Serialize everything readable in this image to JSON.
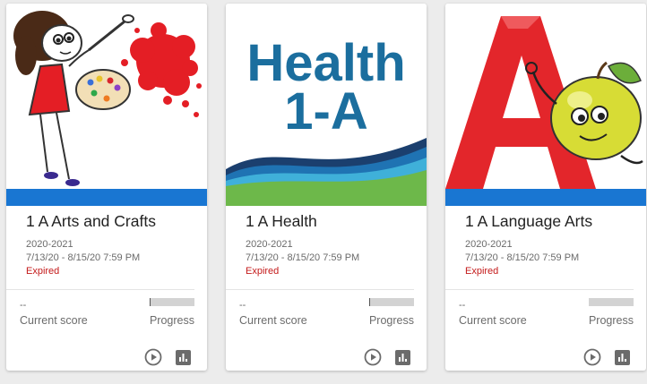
{
  "theme": {
    "accent_color": "#1976d2",
    "status_color": "#c41a1a",
    "icon_color": "#6b6b6b"
  },
  "courses": [
    {
      "thumbnail": "paint-girl-illustration",
      "title": "1 A Arts and Crafts",
      "term": "2020-2021",
      "dates": "7/13/20 - 8/15/20 7:59 PM",
      "status": "Expired",
      "score_value": "--",
      "score_label": "Current score",
      "progress_label": "Progress",
      "progress": 0.02
    },
    {
      "thumbnail": "health-banner",
      "thumb_text_line1": "Health",
      "thumb_text_line2": "1-A",
      "title": "1 A Health",
      "term": "2020-2021",
      "dates": "7/13/20 - 8/15/20 7:59 PM",
      "status": "Expired",
      "score_value": "--",
      "score_label": "Current score",
      "progress_label": "Progress",
      "progress": 0.02
    },
    {
      "thumbnail": "letter-a-apple-illustration",
      "title": "1 A Language Arts",
      "term": "2020-2021",
      "dates": "7/13/20 - 8/15/20 7:59 PM",
      "status": "Expired",
      "score_value": "--",
      "score_label": "Current score",
      "progress_label": "Progress",
      "progress": 0
    }
  ],
  "icons": {
    "play": "play-circle-icon",
    "stats": "bar-chart-icon"
  }
}
